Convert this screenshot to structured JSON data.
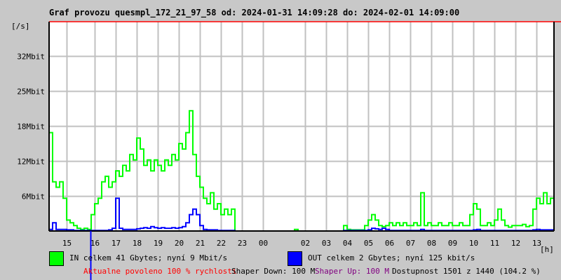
{
  "title": "Graf provozu quesmpl_172_21_97_58 od: 2024-01-31 14:09:28 do: 2024-02-01 14:09:00",
  "chart_data": {
    "type": "line",
    "title": "Graf provozu quesmpl_172_21_97_58 od: 2024-01-31 14:09:28 do: 2024-02-01 14:09:00",
    "ylabel": "[/s]",
    "xlabel": "[h]",
    "y_unit": "Mbit/s",
    "ylim": [
      0,
      38.3
    ],
    "y_ticks": [
      {
        "v": 6.4,
        "label": "6Mbit"
      },
      {
        "v": 12.8,
        "label": "12Mbit"
      },
      {
        "v": 19.2,
        "label": "18Mbit"
      },
      {
        "v": 25.6,
        "label": "25Mbit"
      },
      {
        "v": 32,
        "label": "32Mbit"
      }
    ],
    "x_range_hours": [
      14.15,
      38.15
    ],
    "x_ticks": [
      {
        "h": 15,
        "label": "15"
      },
      {
        "h": 16.33,
        "label": "16"
      },
      {
        "h": 17.33,
        "label": "17"
      },
      {
        "h": 18.33,
        "label": "18"
      },
      {
        "h": 19.33,
        "label": "19"
      },
      {
        "h": 20.33,
        "label": "20"
      },
      {
        "h": 21.33,
        "label": "21"
      },
      {
        "h": 22.33,
        "label": "22"
      },
      {
        "h": 23.33,
        "label": "23"
      },
      {
        "h": 24.33,
        "label": "00"
      },
      {
        "h": 26.33,
        "label": "02"
      },
      {
        "h": 27.33,
        "label": "03"
      },
      {
        "h": 28.33,
        "label": "04"
      },
      {
        "h": 29.33,
        "label": "05"
      },
      {
        "h": 30.33,
        "label": "06"
      },
      {
        "h": 31.33,
        "label": "07"
      },
      {
        "h": 32.33,
        "label": "08"
      },
      {
        "h": 33.33,
        "label": "09"
      },
      {
        "h": 34.33,
        "label": "10"
      },
      {
        "h": 35.33,
        "label": "11"
      },
      {
        "h": 36.33,
        "label": "12"
      },
      {
        "h": 37.33,
        "label": "13"
      }
    ],
    "marker_hour": 16.1,
    "limit_line": 38.3,
    "series": [
      {
        "name": "IN",
        "color": "#00ff00",
        "values": [
          18,
          9,
          8,
          9,
          6,
          2,
          1.5,
          1,
          0.5,
          0.3,
          0.5,
          0.3,
          3,
          5,
          6,
          9,
          10,
          8,
          9,
          11,
          10,
          12,
          11,
          14,
          13,
          17,
          15,
          12,
          13,
          11,
          13,
          12,
          11,
          13,
          12,
          14,
          13,
          16,
          15,
          18,
          22,
          14,
          10,
          8,
          6,
          5,
          7,
          4,
          5,
          3,
          4,
          3,
          4,
          0,
          0,
          0,
          0,
          0,
          0,
          0,
          0,
          0,
          0,
          0,
          0,
          0,
          0,
          0,
          0,
          0,
          0.3,
          0,
          0,
          0,
          0,
          0,
          0,
          0,
          0,
          0,
          0,
          0,
          0,
          0,
          1,
          0.3,
          0.2,
          0.2,
          0.2,
          0.2,
          1,
          2,
          3,
          2,
          1,
          0.8,
          1,
          1.5,
          1,
          1.5,
          1,
          1.5,
          1,
          1,
          1.5,
          1,
          7,
          1,
          1.5,
          1,
          1,
          1.5,
          1,
          1,
          1.5,
          1,
          1,
          1.5,
          1,
          1,
          3,
          5,
          4,
          1,
          1,
          1.5,
          1,
          2,
          4,
          2,
          1,
          0.7,
          1,
          1,
          1,
          1.2,
          0.8,
          1,
          4,
          6,
          5,
          7,
          5,
          6
        ]
      },
      {
        "name": "OUT",
        "color": "#0000ff",
        "values": [
          0.3,
          1.5,
          0.3,
          0.3,
          0.3,
          0.2,
          0.2,
          0.1,
          0.1,
          0.1,
          0.1,
          0.1,
          0.1,
          0.1,
          0.1,
          0.1,
          0.1,
          0.2,
          0.5,
          6,
          0.5,
          0.3,
          0.3,
          0.3,
          0.3,
          0.4,
          0.5,
          0.6,
          0.5,
          0.8,
          0.6,
          0.5,
          0.6,
          0.5,
          0.5,
          0.6,
          0.5,
          0.6,
          0.8,
          1.5,
          3,
          4,
          3,
          1,
          0.3,
          0.2,
          0.2,
          0.2,
          0.1,
          0.1,
          0.1,
          0.1,
          0.1,
          0,
          0,
          0,
          0,
          0,
          0,
          0,
          0,
          0,
          0,
          0,
          0,
          0,
          0,
          0,
          0,
          0,
          0,
          0,
          0,
          0,
          0,
          0,
          0,
          0,
          0,
          0,
          0,
          0,
          0,
          0,
          0.1,
          0.1,
          0.1,
          0.1,
          0.1,
          0.1,
          0.1,
          0.2,
          0.5,
          0.4,
          0.3,
          0.5,
          0.3,
          0.1,
          0.1,
          0.1,
          0.1,
          0.1,
          0.1,
          0.1,
          0.1,
          0.1,
          0.3,
          0.1,
          0.1,
          0.1,
          0.1,
          0.1,
          0.1,
          0.1,
          0.1,
          0.1,
          0.1,
          0.1,
          0.1,
          0.1,
          0.1,
          0.2,
          0.3,
          0.1,
          0.1,
          0.1,
          0.1,
          0.1,
          0.1,
          0.1,
          0.1,
          0.1,
          0.1,
          0.1,
          0.1,
          0.1,
          0.1,
          0.1,
          0.2,
          0.3,
          0.2,
          0.2,
          0.2,
          0.2
        ]
      }
    ]
  },
  "legend": {
    "in_text": "IN celkem 41 Gbytes; nyní 9 Mbit/s",
    "out_text": "OUT celkem 2 Gbytes; nyní 125 kbit/s",
    "in_color": "#00ff00",
    "out_color": "#0000ff"
  },
  "status": {
    "allowed": "Aktualne povoleno 100 % rychlosti",
    "shaper_down": "Shaper Down: 100 M",
    "shaper_up": "Shaper Up: 100 M",
    "availability": "Dostupnost 1501 z 1440 (104.2 %)"
  }
}
